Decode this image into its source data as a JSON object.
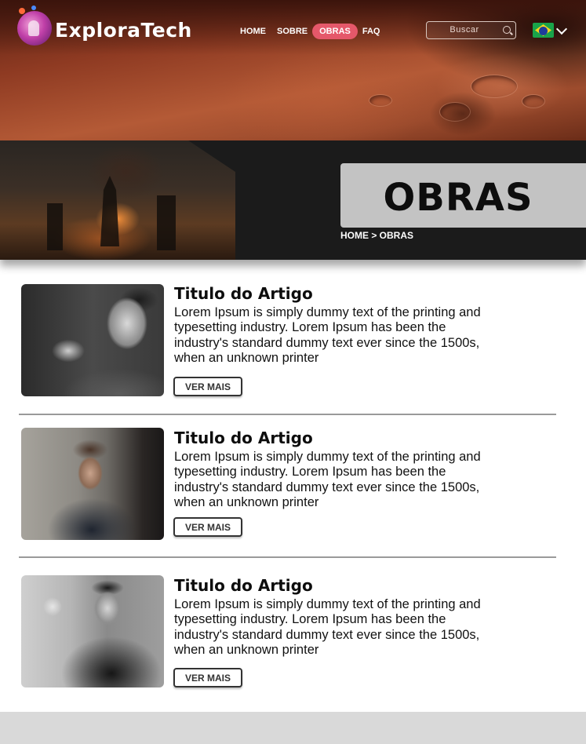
{
  "header": {
    "brand": "ExploraTech",
    "nav": [
      {
        "label": "HOME"
      },
      {
        "label": "SOBRE"
      },
      {
        "label": "OBRAS",
        "active": true
      },
      {
        "label": "FAQ"
      }
    ],
    "search": {
      "placeholder": "Buscar",
      "value": ""
    },
    "language": {
      "flag": "brazil-flag-icon"
    },
    "colors": {
      "active_nav": "#e5586a"
    }
  },
  "banner": {
    "title": "OBRAS",
    "breadcrumb": "HOME > OBRAS"
  },
  "articles": [
    {
      "title": "Titulo do Artigo",
      "body": "Lorem Ipsum is simply dummy text of the printing and typesetting industry. Lorem Ipsum has been the industry's standard dummy text ever since the 1500s, when an unknown printer",
      "button": "VER MAIS"
    },
    {
      "title": "Titulo do Artigo",
      "body": "Lorem Ipsum is simply dummy text of the printing and typesetting industry. Lorem Ipsum has been the industry's standard dummy text ever since the 1500s, when an unknown printer",
      "button": "VER MAIS"
    },
    {
      "title": "Titulo do Artigo",
      "body": "Lorem Ipsum is simply dummy text of the printing and typesetting industry. Lorem Ipsum has been the industry's standard dummy text ever since the 1500s, when an unknown printer",
      "button": "VER MAIS"
    }
  ]
}
